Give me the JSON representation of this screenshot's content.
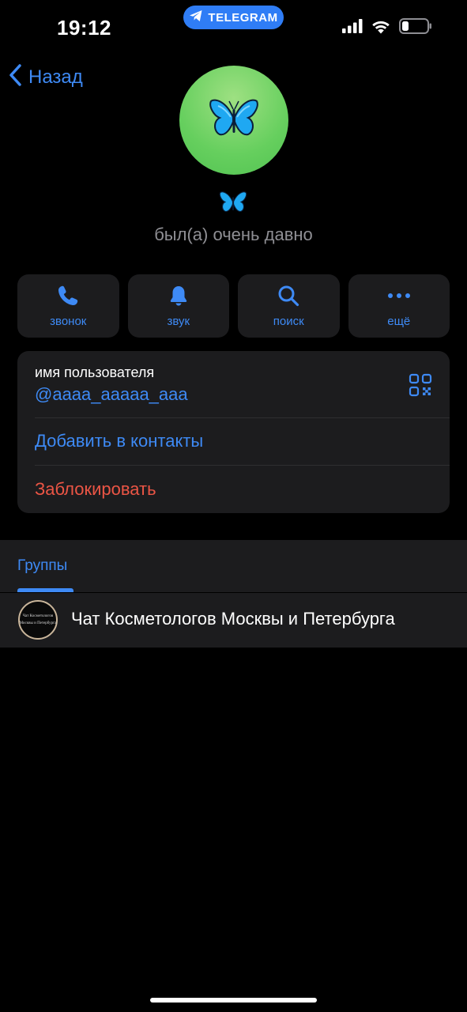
{
  "status_bar": {
    "time": "19:12",
    "app_pill": "TELEGRAM",
    "signal_icon": "cellular-signal-icon",
    "wifi_icon": "wifi-icon",
    "battery_icon": "battery-icon",
    "battery_level": 0.2
  },
  "nav": {
    "back_label": "Назад",
    "back_icon": "chevron-left-icon"
  },
  "profile": {
    "avatar_icon": "butterfly-icon",
    "avatar_color": "#66cf5e",
    "name_icon": "butterfly-icon",
    "last_seen": "был(а) очень давно"
  },
  "actions": [
    {
      "label": "звонок",
      "icon": "phone-icon"
    },
    {
      "label": "звук",
      "icon": "bell-icon"
    },
    {
      "label": "поиск",
      "icon": "search-icon"
    },
    {
      "label": "ещё",
      "icon": "more-icon"
    }
  ],
  "info": {
    "username_caption": "имя пользователя",
    "username_value": "@aaaa_aaaaa_aaa",
    "qr_icon": "qr-code-icon",
    "add_contact": "Добавить в контакты",
    "block": "Заблокировать"
  },
  "groups": {
    "tab_label": "Группы",
    "items": [
      {
        "name": "Чат Косметологов Москвы и Петербурга",
        "avatar_line1": "Чат Косметологов",
        "avatar_line2": "Москвы и Петербурга"
      }
    ]
  },
  "colors": {
    "accent": "#3e8af5",
    "destructive": "#eb5545",
    "card": "#1c1c1e",
    "background": "#000000"
  }
}
